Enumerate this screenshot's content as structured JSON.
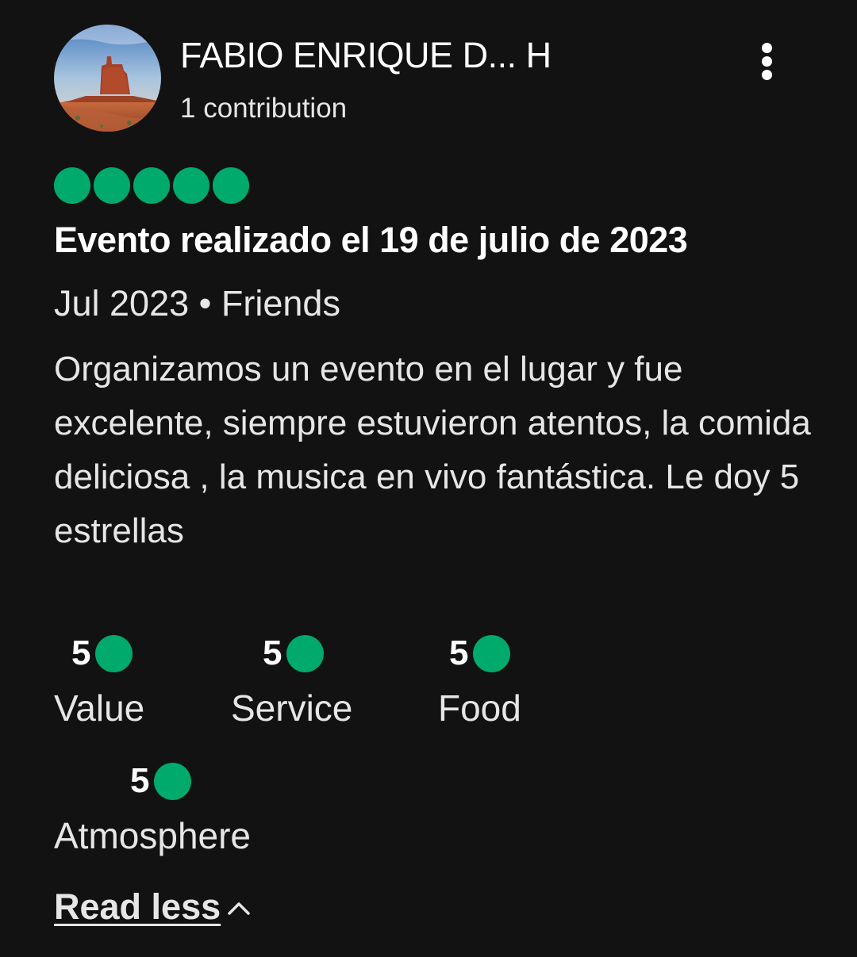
{
  "reviewer": {
    "name": "FABIO ENRIQUE D... H",
    "contributions": "1 contribution",
    "avatar_icon": "monument-valley-photo-avatar"
  },
  "menu": {
    "icon": "more-vertical-icon"
  },
  "review": {
    "rating": 5,
    "rating_max": 5,
    "bubble_color": "#00aa6c",
    "title": "Evento realizado el 19 de julio de 2023",
    "meta": "Jul 2023 • Friends",
    "body": "Organizamos un evento en el lugar y fue excelente, siempre estuvieron atentos, la comida deliciosa , la musica en vivo fantástica. Le doy 5 estrellas"
  },
  "sub_ratings": [
    {
      "score": "5",
      "label": "Value"
    },
    {
      "score": "5",
      "label": "Service"
    },
    {
      "score": "5",
      "label": "Food"
    },
    {
      "score": "5",
      "label": "Atmosphere"
    }
  ],
  "read_less": {
    "label": "Read less",
    "icon": "chevron-up-icon"
  }
}
